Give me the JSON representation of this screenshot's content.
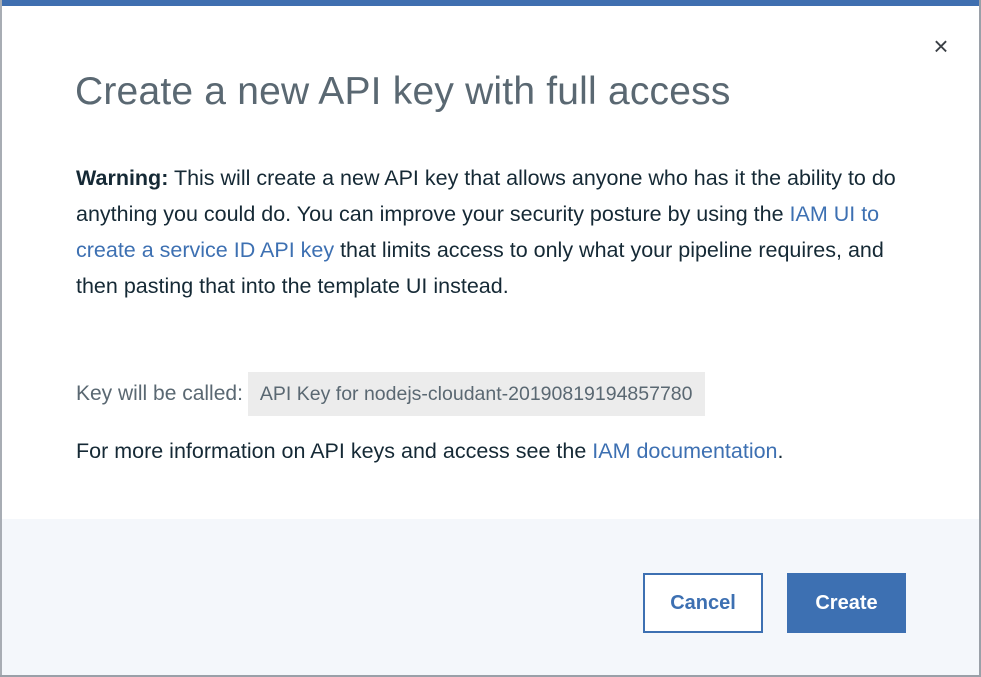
{
  "dialog": {
    "title": "Create a new API key with full access",
    "close_glyph": "×",
    "warning": {
      "label": "Warning:",
      "text_before_link": " This will create a new API key that allows anyone who has it the ability to do anything you could do. You can improve your security posture by using the ",
      "link": "IAM UI to create a service ID API key",
      "text_after_link": " that limits access to only what your pipeline requires, and then pasting that into the template UI instead."
    },
    "key": {
      "label": "Key will be called:",
      "value": "API Key for nodejs-cloudant-20190819194857780"
    },
    "info": {
      "text_before_link": "For more information on API keys and access see the ",
      "link": "IAM documentation",
      "text_after_link": "."
    },
    "buttons": {
      "cancel": "Cancel",
      "create": "Create"
    }
  },
  "colors": {
    "accent": "#3d70b2",
    "title": "#5a6872",
    "text": "#152935",
    "footer_bg": "#f4f7fb",
    "key_bg": "#ececec"
  }
}
